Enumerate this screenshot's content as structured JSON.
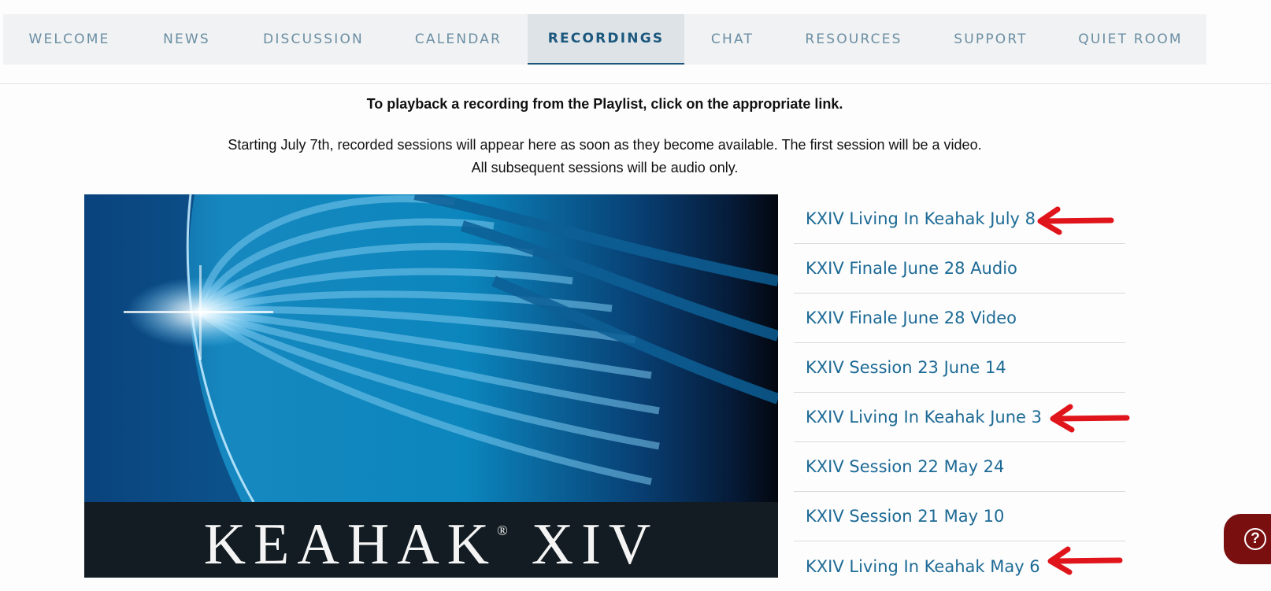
{
  "nav": {
    "tabs": [
      {
        "label": "WELCOME",
        "active": false
      },
      {
        "label": "NEWS",
        "active": false
      },
      {
        "label": "DISCUSSION",
        "active": false
      },
      {
        "label": "CALENDAR",
        "active": false
      },
      {
        "label": "RECORDINGS",
        "active": true
      },
      {
        "label": "CHAT",
        "active": false
      },
      {
        "label": "RESOURCES",
        "active": false
      },
      {
        "label": "SUPPORT",
        "active": false
      },
      {
        "label": "QUIET ROOM",
        "active": false
      }
    ]
  },
  "content": {
    "instructions": "To playback a recording from the Playlist, click on the appropriate link.",
    "note_line1": "Starting July 7th, recorded sessions will appear here as soon as they become available. The first session will be a video.",
    "note_line2": "All subsequent sessions will be audio only."
  },
  "cover": {
    "title": "KEAHAK",
    "registered_mark": "®",
    "numeral": "XIV"
  },
  "playlist": {
    "items": [
      {
        "label": "KXIV Living In Keahak July 8",
        "highlighted": true
      },
      {
        "label": "KXIV Finale June 28 Audio",
        "highlighted": false
      },
      {
        "label": "KXIV Finale June 28 Video",
        "highlighted": false
      },
      {
        "label": "KXIV Session 23 June 14",
        "highlighted": false
      },
      {
        "label": "KXIV Living In Keahak June 3",
        "highlighted": true
      },
      {
        "label": "KXIV Session 22 May 24",
        "highlighted": false
      },
      {
        "label": "KXIV Session 21 May 10",
        "highlighted": false
      },
      {
        "label": "KXIV Living In Keahak May 6",
        "highlighted": true
      }
    ]
  },
  "help": {
    "icon": "question-circle-icon"
  },
  "colors": {
    "link": "#1d6a95",
    "nav_text": "#6a8ea3",
    "nav_active": "#1c587d",
    "annotation_arrow": "#e0151b",
    "help_button": "#7a0f0f"
  }
}
